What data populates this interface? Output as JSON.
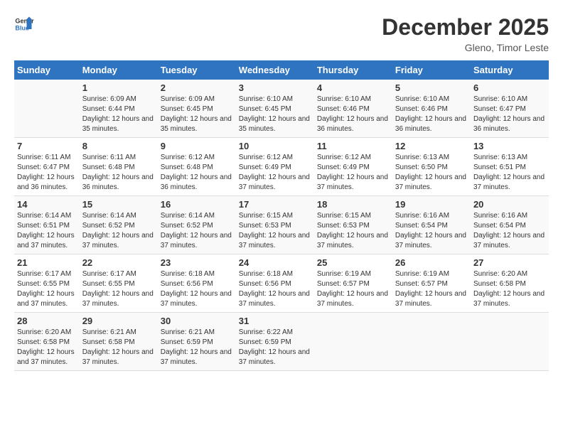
{
  "header": {
    "logo_line1": "General",
    "logo_line2": "Blue",
    "month_title": "December 2025",
    "location": "Gleno, Timor Leste"
  },
  "days_of_week": [
    "Sunday",
    "Monday",
    "Tuesday",
    "Wednesday",
    "Thursday",
    "Friday",
    "Saturday"
  ],
  "weeks": [
    [
      {
        "day": "",
        "sunrise": "",
        "sunset": "",
        "daylight": ""
      },
      {
        "day": "1",
        "sunrise": "Sunrise: 6:09 AM",
        "sunset": "Sunset: 6:44 PM",
        "daylight": "Daylight: 12 hours and 35 minutes."
      },
      {
        "day": "2",
        "sunrise": "Sunrise: 6:09 AM",
        "sunset": "Sunset: 6:45 PM",
        "daylight": "Daylight: 12 hours and 35 minutes."
      },
      {
        "day": "3",
        "sunrise": "Sunrise: 6:10 AM",
        "sunset": "Sunset: 6:45 PM",
        "daylight": "Daylight: 12 hours and 35 minutes."
      },
      {
        "day": "4",
        "sunrise": "Sunrise: 6:10 AM",
        "sunset": "Sunset: 6:46 PM",
        "daylight": "Daylight: 12 hours and 36 minutes."
      },
      {
        "day": "5",
        "sunrise": "Sunrise: 6:10 AM",
        "sunset": "Sunset: 6:46 PM",
        "daylight": "Daylight: 12 hours and 36 minutes."
      },
      {
        "day": "6",
        "sunrise": "Sunrise: 6:10 AM",
        "sunset": "Sunset: 6:47 PM",
        "daylight": "Daylight: 12 hours and 36 minutes."
      }
    ],
    [
      {
        "day": "7",
        "sunrise": "Sunrise: 6:11 AM",
        "sunset": "Sunset: 6:47 PM",
        "daylight": "Daylight: 12 hours and 36 minutes."
      },
      {
        "day": "8",
        "sunrise": "Sunrise: 6:11 AM",
        "sunset": "Sunset: 6:48 PM",
        "daylight": "Daylight: 12 hours and 36 minutes."
      },
      {
        "day": "9",
        "sunrise": "Sunrise: 6:12 AM",
        "sunset": "Sunset: 6:48 PM",
        "daylight": "Daylight: 12 hours and 36 minutes."
      },
      {
        "day": "10",
        "sunrise": "Sunrise: 6:12 AM",
        "sunset": "Sunset: 6:49 PM",
        "daylight": "Daylight: 12 hours and 37 minutes."
      },
      {
        "day": "11",
        "sunrise": "Sunrise: 6:12 AM",
        "sunset": "Sunset: 6:49 PM",
        "daylight": "Daylight: 12 hours and 37 minutes."
      },
      {
        "day": "12",
        "sunrise": "Sunrise: 6:13 AM",
        "sunset": "Sunset: 6:50 PM",
        "daylight": "Daylight: 12 hours and 37 minutes."
      },
      {
        "day": "13",
        "sunrise": "Sunrise: 6:13 AM",
        "sunset": "Sunset: 6:51 PM",
        "daylight": "Daylight: 12 hours and 37 minutes."
      }
    ],
    [
      {
        "day": "14",
        "sunrise": "Sunrise: 6:14 AM",
        "sunset": "Sunset: 6:51 PM",
        "daylight": "Daylight: 12 hours and 37 minutes."
      },
      {
        "day": "15",
        "sunrise": "Sunrise: 6:14 AM",
        "sunset": "Sunset: 6:52 PM",
        "daylight": "Daylight: 12 hours and 37 minutes."
      },
      {
        "day": "16",
        "sunrise": "Sunrise: 6:14 AM",
        "sunset": "Sunset: 6:52 PM",
        "daylight": "Daylight: 12 hours and 37 minutes."
      },
      {
        "day": "17",
        "sunrise": "Sunrise: 6:15 AM",
        "sunset": "Sunset: 6:53 PM",
        "daylight": "Daylight: 12 hours and 37 minutes."
      },
      {
        "day": "18",
        "sunrise": "Sunrise: 6:15 AM",
        "sunset": "Sunset: 6:53 PM",
        "daylight": "Daylight: 12 hours and 37 minutes."
      },
      {
        "day": "19",
        "sunrise": "Sunrise: 6:16 AM",
        "sunset": "Sunset: 6:54 PM",
        "daylight": "Daylight: 12 hours and 37 minutes."
      },
      {
        "day": "20",
        "sunrise": "Sunrise: 6:16 AM",
        "sunset": "Sunset: 6:54 PM",
        "daylight": "Daylight: 12 hours and 37 minutes."
      }
    ],
    [
      {
        "day": "21",
        "sunrise": "Sunrise: 6:17 AM",
        "sunset": "Sunset: 6:55 PM",
        "daylight": "Daylight: 12 hours and 37 minutes."
      },
      {
        "day": "22",
        "sunrise": "Sunrise: 6:17 AM",
        "sunset": "Sunset: 6:55 PM",
        "daylight": "Daylight: 12 hours and 37 minutes."
      },
      {
        "day": "23",
        "sunrise": "Sunrise: 6:18 AM",
        "sunset": "Sunset: 6:56 PM",
        "daylight": "Daylight: 12 hours and 37 minutes."
      },
      {
        "day": "24",
        "sunrise": "Sunrise: 6:18 AM",
        "sunset": "Sunset: 6:56 PM",
        "daylight": "Daylight: 12 hours and 37 minutes."
      },
      {
        "day": "25",
        "sunrise": "Sunrise: 6:19 AM",
        "sunset": "Sunset: 6:57 PM",
        "daylight": "Daylight: 12 hours and 37 minutes."
      },
      {
        "day": "26",
        "sunrise": "Sunrise: 6:19 AM",
        "sunset": "Sunset: 6:57 PM",
        "daylight": "Daylight: 12 hours and 37 minutes."
      },
      {
        "day": "27",
        "sunrise": "Sunrise: 6:20 AM",
        "sunset": "Sunset: 6:58 PM",
        "daylight": "Daylight: 12 hours and 37 minutes."
      }
    ],
    [
      {
        "day": "28",
        "sunrise": "Sunrise: 6:20 AM",
        "sunset": "Sunset: 6:58 PM",
        "daylight": "Daylight: 12 hours and 37 minutes."
      },
      {
        "day": "29",
        "sunrise": "Sunrise: 6:21 AM",
        "sunset": "Sunset: 6:58 PM",
        "daylight": "Daylight: 12 hours and 37 minutes."
      },
      {
        "day": "30",
        "sunrise": "Sunrise: 6:21 AM",
        "sunset": "Sunset: 6:59 PM",
        "daylight": "Daylight: 12 hours and 37 minutes."
      },
      {
        "day": "31",
        "sunrise": "Sunrise: 6:22 AM",
        "sunset": "Sunset: 6:59 PM",
        "daylight": "Daylight: 12 hours and 37 minutes."
      },
      {
        "day": "",
        "sunrise": "",
        "sunset": "",
        "daylight": ""
      },
      {
        "day": "",
        "sunrise": "",
        "sunset": "",
        "daylight": ""
      },
      {
        "day": "",
        "sunrise": "",
        "sunset": "",
        "daylight": ""
      }
    ]
  ]
}
